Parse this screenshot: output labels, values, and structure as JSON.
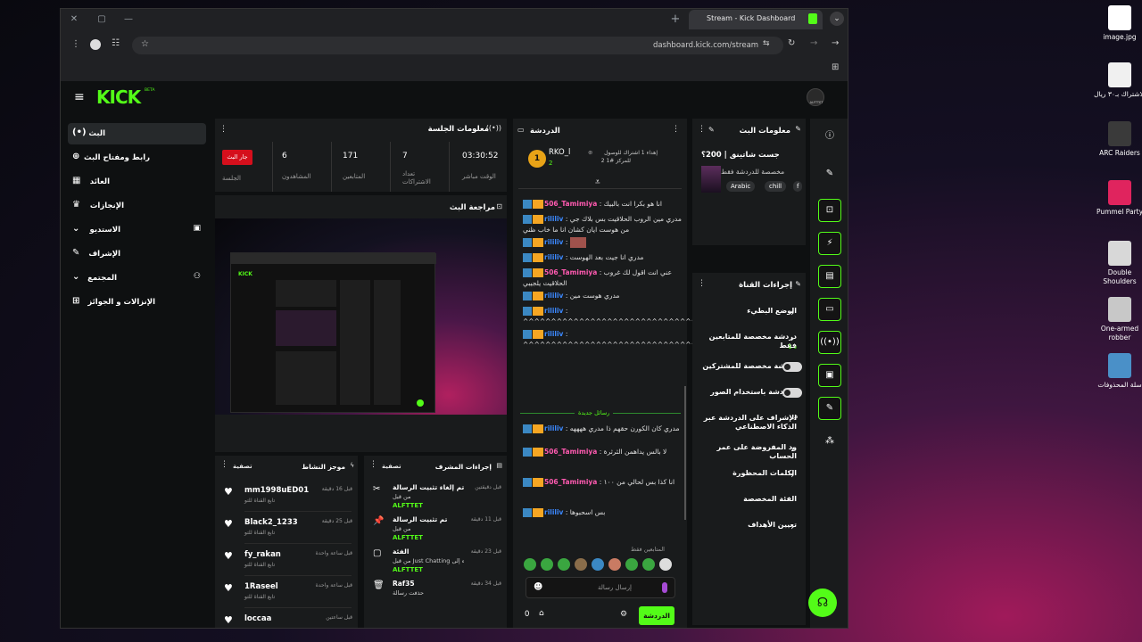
{
  "browser": {
    "tab_title": "Stream - Kick Dashboard",
    "url": "dashboard.kick.com/stream",
    "min": "—",
    "restore": "▢",
    "close": "✕",
    "newtab": "+"
  },
  "header": {
    "logo": "KICK",
    "beta": "BETA",
    "avatar_label": "ALFTTET"
  },
  "sidebar": {
    "items": [
      {
        "label": "البث",
        "icon": "(•)"
      },
      {
        "label": "رابط ومفتاح البث",
        "icon": "⊕"
      },
      {
        "label": "العائد",
        "icon": "▦"
      },
      {
        "label": "الإنجازات",
        "icon": "♛"
      },
      {
        "label": "الاستديو",
        "icon": "▣",
        "chev": "⌄"
      },
      {
        "label": "الإشراف",
        "icon": "✎"
      },
      {
        "label": "المجتمع",
        "icon": "⚇",
        "chev": "⌄"
      },
      {
        "label": "الإنزالات و الجوائز",
        "icon": "⊞"
      }
    ]
  },
  "session": {
    "title": "معلومات الجلسة",
    "status": "جار البث",
    "status_label": "الجلسة",
    "stats": [
      {
        "value": "6",
        "label": "المشاهدون"
      },
      {
        "value": "171",
        "label": "المتابعين"
      },
      {
        "value": "7",
        "label": "تعداد الاشتراكات"
      },
      {
        "value": "03:30:52",
        "label": "الوقت مباشر"
      }
    ]
  },
  "review": {
    "title": "مراجعة البث"
  },
  "activity": {
    "title": "موجز النشاط",
    "filter": "تصفية",
    "items": [
      {
        "name": "mm1998uED01",
        "desc": "تابع القناة للتو",
        "time": "قبل 16 دقيقة"
      },
      {
        "name": "Black2_1233",
        "desc": "تابع القناة للتو",
        "time": "قبل 25 دقيقة"
      },
      {
        "name": "fy_rakan",
        "desc": "تابع القناة للتو",
        "time": "قبل ساعة واحدة"
      },
      {
        "name": "1Raseel",
        "desc": "تابع القناة للتو",
        "time": "قبل ساعة واحدة"
      },
      {
        "name": "loccaa",
        "desc": "",
        "time": "قبل ساعتين"
      }
    ]
  },
  "modactions": {
    "title": "إجراءات المشرف",
    "filter": "تصفية",
    "items": [
      {
        "action": "تم إلغاء تثبيت الرسالة",
        "by": "من قبل",
        "user": "ALFTTET",
        "time": "قبل دقيقتين",
        "icon": "✂"
      },
      {
        "action": "تم تثبيت الرسالة",
        "by": "من قبل",
        "user": "ALFTTET",
        "time": "قبل 11 دقيقة",
        "icon": "📌"
      },
      {
        "action": "الفئة",
        "by": "من قبل Just Chatting تم تغييره إلى",
        "user": "ALFTTET",
        "time": "قبل 23 دقيقة",
        "icon": "▢"
      },
      {
        "action": "Raf35",
        "by": "حذفت رسالة",
        "user": "",
        "time": "قبل 34 دقيقة",
        "icon": "🗑"
      }
    ]
  },
  "chat": {
    "title": "الدردشة",
    "pinned_user": "RKO_l",
    "pinned_rank": "1",
    "pinned_count": "2",
    "goal_text": "إهداء 1 اشتراك للوصول",
    "goal_sub": "2 للمركز #1",
    "messages": [
      {
        "user": "506_Tamimiya",
        "color": "#ff5ab0",
        "text": "انا هو بكرا انت بالبيك"
      },
      {
        "user": "rililiv",
        "color": "#3b88ff",
        "text": "مدري مين الروب الحلاقيت بس بلاك جي من هوست ايان كشان انا ما خاب ظني"
      },
      {
        "user": "rililiv",
        "color": "#3b88ff",
        "text": ""
      },
      {
        "user": "rililiv",
        "color": "#3b88ff",
        "text": "مدري انا جيت بعد الهوست"
      },
      {
        "user": "506_Tamimiya",
        "color": "#ff5ab0",
        "text": "عني انت اقول لك غروب الحلاقيت يلجيبي"
      },
      {
        "user": "rililiv",
        "color": "#3b88ff",
        "text": "مدري هوست مين"
      },
      {
        "user": "rililiv",
        "color": "#3b88ff",
        "text": "^^^^^^^^^^^^^^^^^^^^^^^^^^^^^^^^"
      },
      {
        "user": "rililiv",
        "color": "#3b88ff",
        "text": "^^^^^^^^^^^^^^^^^^^^^^^^^^^^^^^^"
      }
    ],
    "new_label": "رسائل جديدة",
    "new_messages": [
      {
        "user": "rililiv",
        "color": "#3b88ff",
        "text": "مدري كان الكورن حقهم ذا مدري ههههه"
      },
      {
        "user": "506_Tamimiya",
        "color": "#ff5ab0",
        "text": "لا بالس يداهمن الثرثرة"
      },
      {
        "user": "506_Tamimiya",
        "color": "#ff5ab0",
        "text": "انا كذا بس لحالي من ١٠٠"
      },
      {
        "user": "rililiv",
        "color": "#3b88ff",
        "text": "بس اسحبوها"
      }
    ],
    "followers_only": "المتابعين فقط",
    "placeholder": "إرسال رسالة",
    "count": "0",
    "send": "الدردشة"
  },
  "streaminfo": {
    "title": "معلومات البث",
    "stream_title": "جست شاتينق | 200؟",
    "category": "مخصصة للدردشة فقط",
    "tags": [
      "Arabic",
      "chill",
      "f"
    ]
  },
  "channel": {
    "title": "إجراءات القناة",
    "items": [
      {
        "label": "الوضع البطيء",
        "type": "chev"
      },
      {
        "label": "دردشة مخصصة للمتابعين فقط",
        "sub": "1 د",
        "type": "chev"
      },
      {
        "label": "دردشة مخصصة للمشتركين",
        "type": "toggle"
      },
      {
        "label": "الدردشة باستخدام الصور",
        "type": "toggle"
      },
      {
        "label": "الإشراف على الدردشة عبر الذكاء الاصطناعي",
        "type": "ext"
      },
      {
        "label": "ود المفروضة على عمر الحساب",
        "type": "chev"
      },
      {
        "label": "الكلمات المحظورة",
        "type": "chev"
      },
      {
        "label": "الفئة المخصصة",
        "type": "none"
      },
      {
        "label": "تعيين الأهداف",
        "type": "chev"
      }
    ]
  },
  "rightbar": [
    "ⓘ",
    "✎",
    "⊡",
    "⚡",
    "▤",
    "▭",
    "((•))",
    "▣",
    "✎",
    "⁂"
  ],
  "desktop": [
    {
      "label": "image.jpg",
      "color": "#ffffff"
    },
    {
      "label": "الاشتراك بـ٣٠ ريال",
      "color": "#f0f0f0"
    },
    {
      "label": "ARC Raiders",
      "color": "#3a3a3a"
    },
    {
      "label": "Pummel Party",
      "color": "#e0245e"
    },
    {
      "label": "Double Shoulders",
      "color": "#d8d8d8"
    },
    {
      "label": "One-armed robber",
      "color": "#c8c8c8"
    },
    {
      "label": "سلة المحذوفات",
      "color": "#4a90c8"
    }
  ]
}
